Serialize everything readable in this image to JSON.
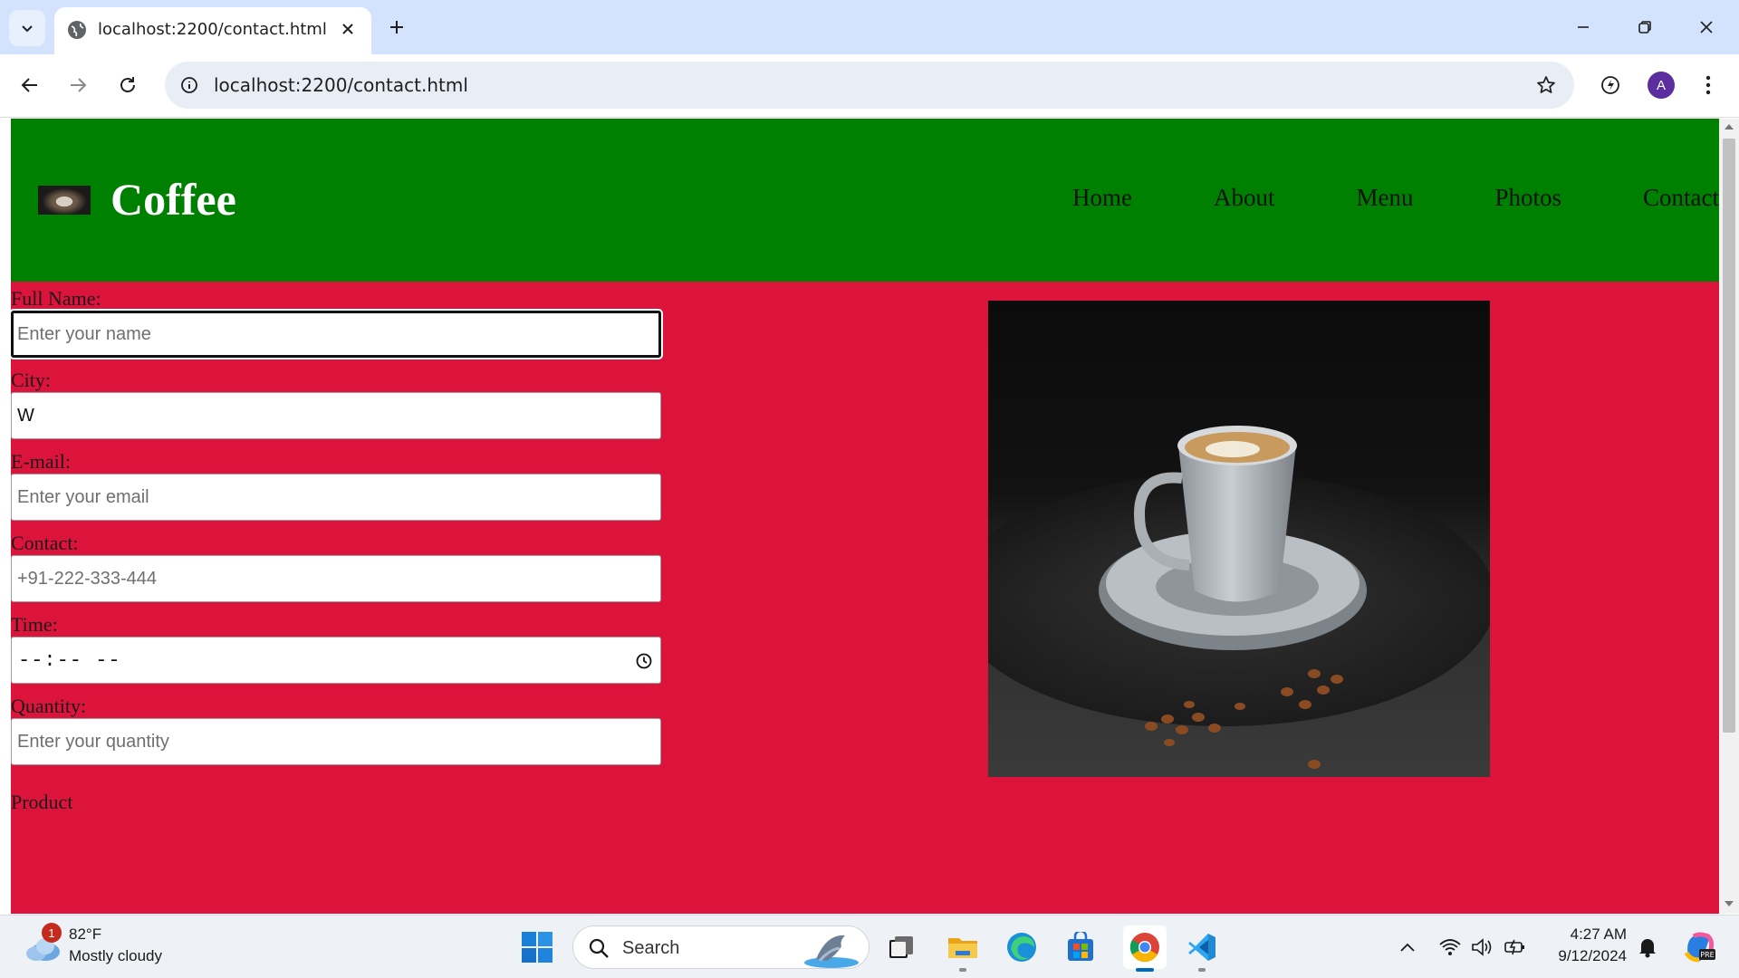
{
  "browser": {
    "tab_title": "localhost:2200/contact.html",
    "url": "localhost:2200/contact.html",
    "profile_initial": "A"
  },
  "site": {
    "title": "Coffee",
    "nav": [
      "Home",
      "About",
      "Menu",
      "Photos",
      "Contact"
    ],
    "colors": {
      "header": "#008000",
      "body": "#dc143c"
    }
  },
  "form": {
    "full_name": {
      "label": "Full Name:",
      "placeholder": "Enter your name",
      "value": ""
    },
    "city": {
      "label": "City:",
      "placeholder": "",
      "value": "W"
    },
    "email": {
      "label": "E-mail:",
      "placeholder": "Enter your email",
      "value": ""
    },
    "contact": {
      "label": "Contact:",
      "placeholder": "+91-222-333-444",
      "value": ""
    },
    "time": {
      "label": "Time:",
      "display": "--:-- --"
    },
    "quantity": {
      "label": "Quantity:",
      "placeholder": "Enter your quantity",
      "value": ""
    },
    "product": {
      "label": "Product"
    }
  },
  "taskbar": {
    "weather_badge": "1",
    "weather_temp": "82°F",
    "weather_condition": "Mostly cloudy",
    "search_label": "Search",
    "time": "4:27 AM",
    "date": "9/12/2024"
  }
}
